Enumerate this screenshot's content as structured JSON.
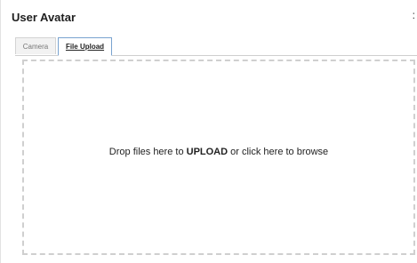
{
  "dialog": {
    "title": "User Avatar",
    "more_label": ":"
  },
  "tabs": [
    {
      "label": "Camera",
      "active": false
    },
    {
      "label": "File Upload",
      "active": true
    }
  ],
  "dropzone": {
    "text_before": "Drop files here to ",
    "text_emphasis": "UPLOAD",
    "text_after": " or click here to browse"
  }
}
